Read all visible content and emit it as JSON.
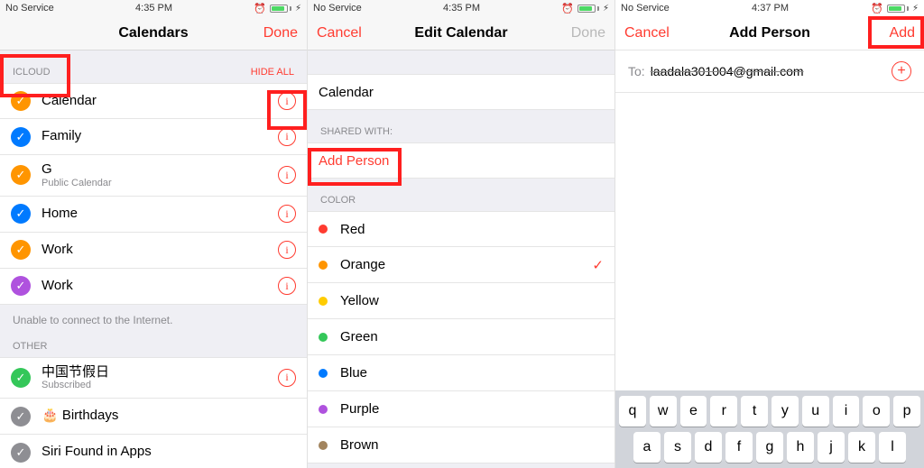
{
  "pane1": {
    "status": {
      "left": "No Service",
      "time": "4:35 PM"
    },
    "nav": {
      "title": "Calendars",
      "right": "Done"
    },
    "sec_icloud": "ICLOUD",
    "hide_all": "HIDE ALL",
    "calendars": [
      {
        "name": "Calendar",
        "color": "o",
        "info": true
      },
      {
        "name": "Family",
        "color": "b",
        "info": true
      },
      {
        "name": "G",
        "sub": "Public Calendar",
        "color": "o",
        "info": true
      },
      {
        "name": "Home",
        "color": "b",
        "info": true
      },
      {
        "name": "Work",
        "color": "o",
        "info": true
      },
      {
        "name": "Work",
        "color": "pu",
        "info": true
      }
    ],
    "note": "Unable to connect to the Internet.",
    "sec_other": "OTHER",
    "other": [
      {
        "name": "中国节假日",
        "sub": "Subscribed",
        "color": "g",
        "info": true
      },
      {
        "name": "🎂 Birthdays",
        "color": "gy",
        "info": false
      },
      {
        "name": "Siri Found in Apps",
        "color": "gy",
        "info": false
      }
    ]
  },
  "pane2": {
    "status": {
      "left": "No Service",
      "time": "4:35 PM"
    },
    "nav": {
      "left": "Cancel",
      "title": "Edit Calendar",
      "right": "Done"
    },
    "cal_name": "Calendar",
    "sec_shared": "SHARED WITH:",
    "add_person": "Add Person",
    "sec_color": "COLOR",
    "colors": [
      {
        "name": "Red",
        "hex": "#ff3b30",
        "sel": false
      },
      {
        "name": "Orange",
        "hex": "#ff9500",
        "sel": true
      },
      {
        "name": "Yellow",
        "hex": "#ffcc00",
        "sel": false
      },
      {
        "name": "Green",
        "hex": "#34c759",
        "sel": false
      },
      {
        "name": "Blue",
        "hex": "#007aff",
        "sel": false
      },
      {
        "name": "Purple",
        "hex": "#af52de",
        "sel": false
      },
      {
        "name": "Brown",
        "hex": "#a2845e",
        "sel": false
      }
    ]
  },
  "pane3": {
    "status": {
      "left": "No Service",
      "time": "4:37 PM"
    },
    "nav": {
      "left": "Cancel",
      "title": "Add Person",
      "right": "Add"
    },
    "to_label": "To:",
    "to_value": "laadala301004@gmail.com",
    "kb_rows": [
      [
        "q",
        "w",
        "e",
        "r",
        "t",
        "y",
        "u",
        "i",
        "o",
        "p"
      ],
      [
        "a",
        "s",
        "d",
        "f",
        "g",
        "h",
        "j",
        "k",
        "l"
      ]
    ]
  }
}
